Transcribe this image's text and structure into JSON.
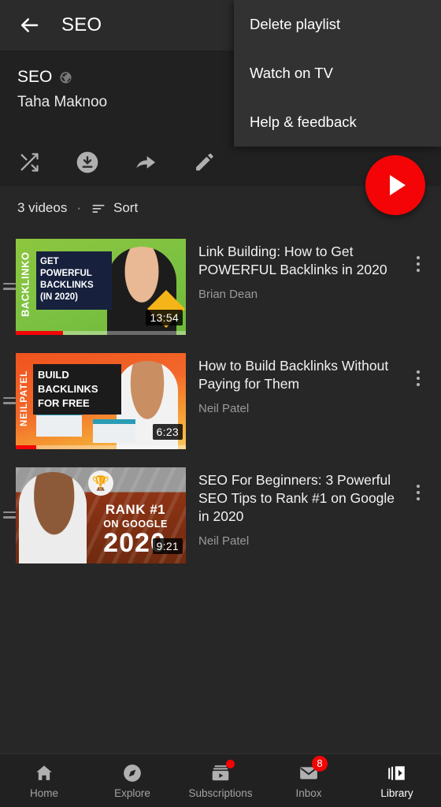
{
  "appbar": {
    "back_icon": "back-arrow-icon",
    "title": "SEO"
  },
  "playlist": {
    "title": "SEO",
    "privacy_icon": "globe-public-icon",
    "owner": "Taha Maknoo",
    "actions": [
      {
        "name": "shuffle",
        "icon": "shuffle-icon"
      },
      {
        "name": "download",
        "icon": "download-circle-icon"
      },
      {
        "name": "share",
        "icon": "share-arrow-icon"
      },
      {
        "name": "edit",
        "icon": "pencil-edit-icon"
      }
    ],
    "play_fab_icon": "play-triangle-icon"
  },
  "listbar": {
    "video_count": "3 videos",
    "separator": "·",
    "sort_icon": "sort-lines-icon",
    "sort_label": "Sort"
  },
  "videos": [
    {
      "title": "Link Building: How to Get POWERFUL Backlinks in 2020",
      "channel": "Brian Dean",
      "duration": "13:54",
      "progress_percent": 28,
      "thumb": {
        "style": "backlinko",
        "brand": "BACKLINKO",
        "line1": "GET POWERFUL",
        "line2": "BACKLINKS",
        "line3": "(IN 2020)"
      },
      "drag_handle_icon": "drag-handle-icon",
      "menu_icon": "more-vertical-icon"
    },
    {
      "title": "How to Build Backlinks Without Paying for Them",
      "channel": "Neil Patel",
      "duration": "6:23",
      "progress_percent": 12,
      "thumb": {
        "style": "neilpatel-free",
        "brand": "NEILPATEL",
        "line1": "BUILD",
        "line2": "BACKLINKS",
        "line3": "FOR FREE"
      },
      "drag_handle_icon": "drag-handle-icon",
      "menu_icon": "more-vertical-icon"
    },
    {
      "title": "SEO For Beginners: 3 Powerful SEO Tips to Rank #1 on Google in 2020",
      "channel": "Neil Patel",
      "duration": "9:21",
      "progress_percent": 0,
      "thumb": {
        "style": "rank-one",
        "trophy_icon": "trophy-icon",
        "line1": "RANK #1",
        "line2": "ON GOOGLE",
        "line3": "2020"
      },
      "drag_handle_icon": "drag-handle-icon",
      "menu_icon": "more-vertical-icon"
    }
  ],
  "overflow_menu": {
    "visible": true,
    "items": [
      {
        "label": "Delete playlist"
      },
      {
        "label": "Watch on TV"
      },
      {
        "label": "Help & feedback"
      }
    ]
  },
  "bottom_nav": {
    "items": [
      {
        "label": "Home",
        "icon": "home-icon",
        "active": false,
        "badge": null
      },
      {
        "label": "Explore",
        "icon": "compass-explore-icon",
        "active": false,
        "badge": null
      },
      {
        "label": "Subscriptions",
        "icon": "subscriptions-icon",
        "active": false,
        "badge": "dot"
      },
      {
        "label": "Inbox",
        "icon": "inbox-envelope-icon",
        "active": false,
        "badge": "8"
      },
      {
        "label": "Library",
        "icon": "library-icon",
        "active": true,
        "badge": null
      }
    ]
  },
  "colors": {
    "background": "#272727",
    "surface": "#212121",
    "appbar": "#2b2b2b",
    "menu": "#323232",
    "accent_red": "#f40407",
    "badge_red": "#f10505",
    "text_primary": "#f1f1f1",
    "text_secondary": "#9a9a9a"
  }
}
